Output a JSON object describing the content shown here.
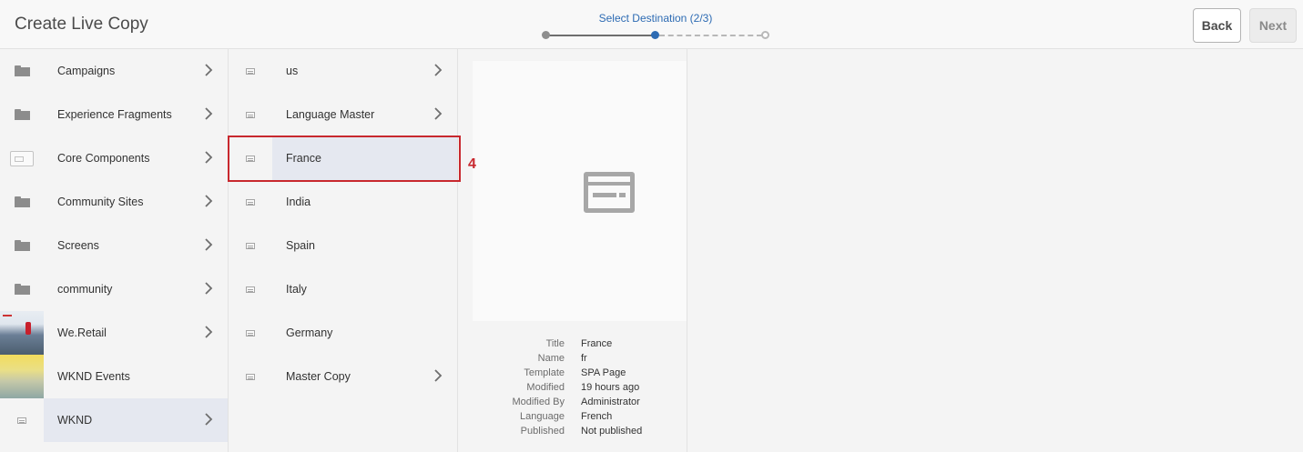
{
  "header": {
    "title": "Create Live Copy",
    "step_label": "Select Destination (2/3)",
    "back_label": "Back",
    "next_label": "Next"
  },
  "column1": {
    "items": [
      {
        "label": "Campaigns",
        "icon": "folder-icon",
        "has_children": true
      },
      {
        "label": "Experience Fragments",
        "icon": "folder-icon",
        "has_children": true
      },
      {
        "label": "Core Components",
        "icon": "component-icon",
        "has_children": true
      },
      {
        "label": "Community Sites",
        "icon": "folder-icon",
        "has_children": true
      },
      {
        "label": "Screens",
        "icon": "folder-icon",
        "has_children": true
      },
      {
        "label": "community",
        "icon": "folder-icon",
        "has_children": true
      },
      {
        "label": "We.Retail",
        "icon": "site-thumbnail",
        "has_children": true
      },
      {
        "label": "WKND Events",
        "icon": "site-thumbnail",
        "has_children": false
      },
      {
        "label": "WKND",
        "icon": "page-icon",
        "has_children": true,
        "selected": true
      }
    ]
  },
  "column2": {
    "items": [
      {
        "label": "us",
        "icon": "page-icon",
        "has_children": true
      },
      {
        "label": "Language Master",
        "icon": "page-icon",
        "has_children": true
      },
      {
        "label": "France",
        "icon": "page-icon",
        "has_children": false,
        "selected": true
      },
      {
        "label": "India",
        "icon": "page-icon",
        "has_children": false
      },
      {
        "label": "Spain",
        "icon": "page-icon",
        "has_children": false
      },
      {
        "label": "Italy",
        "icon": "page-icon",
        "has_children": false
      },
      {
        "label": "Germany",
        "icon": "page-icon",
        "has_children": false
      },
      {
        "label": "Master Copy",
        "icon": "page-icon",
        "has_children": true
      }
    ]
  },
  "annotation": "4",
  "details": [
    {
      "key": "Title",
      "value": "France"
    },
    {
      "key": "Name",
      "value": "fr"
    },
    {
      "key": "Template",
      "value": "SPA Page"
    },
    {
      "key": "Modified",
      "value": "19 hours ago"
    },
    {
      "key": "Modified By",
      "value": "Administrator"
    },
    {
      "key": "Language",
      "value": "French"
    },
    {
      "key": "Published",
      "value": "Not published"
    }
  ],
  "colors": {
    "accent": "#2d6bb3",
    "selection": "#e5e8f0",
    "annotation": "#c8282e"
  }
}
